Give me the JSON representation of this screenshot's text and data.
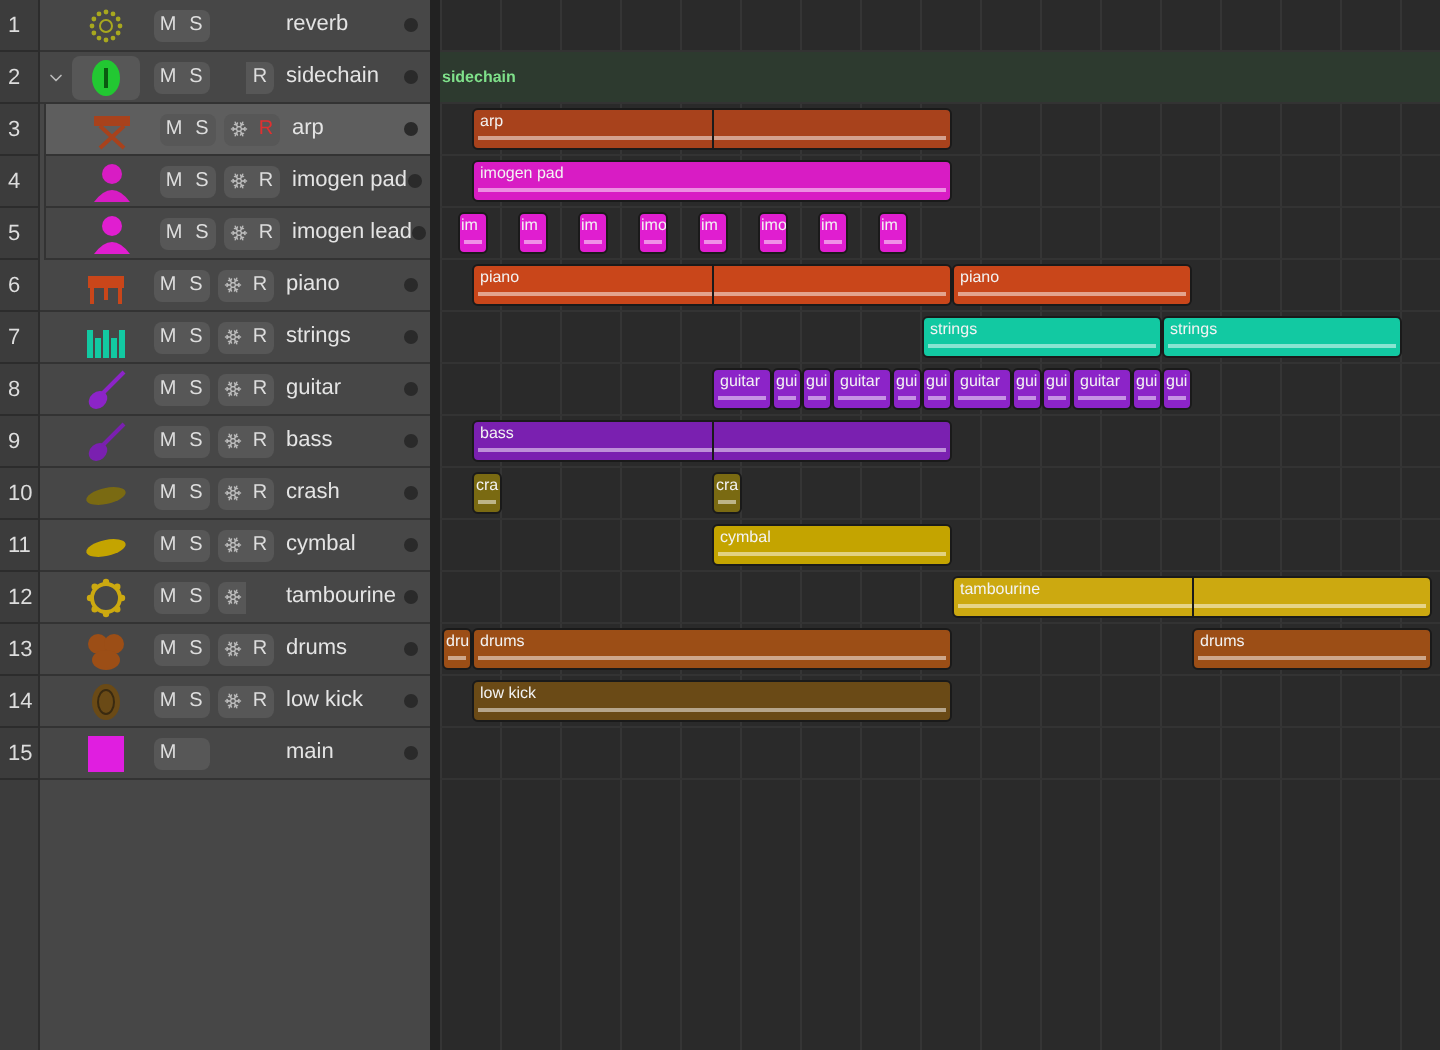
{
  "tracks": [
    {
      "number": "1",
      "name": "reverb",
      "color": "#a8a81e",
      "selected": false,
      "mute": "M",
      "solo": "S",
      "freeze": false
    },
    {
      "number": "2",
      "name": "sidechain",
      "color": "#22c832",
      "selected": false,
      "mute": "M",
      "solo": "S",
      "freeze": false,
      "record": {
        "label": "R",
        "armed": false
      },
      "expanded": true,
      "lane_label": "sidechain",
      "children": [
        {
          "number": "3",
          "name": "arp",
          "color": "#a8421c",
          "selected": true,
          "mute": "M",
          "solo": "S",
          "freeze": true,
          "record": {
            "label": "R",
            "armed": true
          },
          "regions": [
            {
              "label": "arp",
              "split": true
            }
          ]
        },
        {
          "number": "4",
          "name": "imogen pad",
          "color": "#d81cc4",
          "selected": false,
          "mute": "M",
          "solo": "S",
          "freeze": true,
          "record": {
            "label": "R",
            "armed": false
          },
          "regions": [
            {
              "label": "imogen pad"
            }
          ]
        },
        {
          "number": "5",
          "name": "imogen lead",
          "color": "#e01ed0",
          "selected": false,
          "mute": "M",
          "solo": "S",
          "freeze": true,
          "record": {
            "label": "R",
            "armed": false
          },
          "regions": [
            {
              "label": "im"
            },
            {
              "label": "im"
            },
            {
              "label": "im"
            },
            {
              "label": "imo"
            },
            {
              "label": "im"
            },
            {
              "label": "imo"
            },
            {
              "label": "im"
            },
            {
              "label": "im"
            }
          ]
        }
      ]
    },
    {
      "number": "6",
      "name": "piano",
      "color": "#c9461a",
      "selected": false,
      "mute": "M",
      "solo": "S",
      "freeze": true,
      "record": {
        "label": "R",
        "armed": false
      },
      "regions": [
        {
          "label": "piano",
          "split": true
        },
        {
          "label": "piano",
          "split": false
        }
      ]
    },
    {
      "number": "7",
      "name": "strings",
      "color": "#12c9a2",
      "selected": false,
      "mute": "M",
      "solo": "S",
      "freeze": true,
      "record": {
        "label": "R",
        "armed": false
      },
      "regions": [
        {
          "label": "strings"
        },
        {
          "label": "strings"
        }
      ]
    },
    {
      "number": "8",
      "name": "guitar",
      "color": "#8c24c8",
      "selected": false,
      "mute": "M",
      "solo": "S",
      "freeze": true,
      "record": {
        "label": "R",
        "armed": false
      },
      "regions": [
        {
          "label": "guitar"
        },
        {
          "label": "gui"
        },
        {
          "label": "gui"
        },
        {
          "label": "guitar"
        },
        {
          "label": "gui"
        },
        {
          "label": "gui"
        },
        {
          "label": "guitar"
        },
        {
          "label": "gui"
        },
        {
          "label": "gui"
        },
        {
          "label": "guitar"
        },
        {
          "label": "gui"
        },
        {
          "label": "gui"
        }
      ]
    },
    {
      "number": "9",
      "name": "bass",
      "color": "#7a20b0",
      "selected": false,
      "mute": "M",
      "solo": "S",
      "freeze": true,
      "record": {
        "label": "R",
        "armed": false
      },
      "regions": [
        {
          "label": "bass",
          "split": true
        }
      ]
    },
    {
      "number": "10",
      "name": "crash",
      "color": "#7a6a12",
      "selected": false,
      "mute": "M",
      "solo": "S",
      "freeze": true,
      "record": {
        "label": "R",
        "armed": false
      },
      "regions": [
        {
          "label": "cra"
        },
        {
          "label": "cra"
        }
      ]
    },
    {
      "number": "11",
      "name": "cymbal",
      "color": "#c4a400",
      "selected": false,
      "mute": "M",
      "solo": "S",
      "freeze": true,
      "record": {
        "label": "R",
        "armed": false
      },
      "regions": [
        {
          "label": "cymbal"
        }
      ]
    },
    {
      "number": "12",
      "name": "tambourine",
      "color": "#cca910",
      "selected": false,
      "mute": "M",
      "solo": "S",
      "freeze": true,
      "regions": [
        {
          "label": "tambourine",
          "split": true
        }
      ]
    },
    {
      "number": "13",
      "name": "drums",
      "color": "#9c4e16",
      "selected": false,
      "mute": "M",
      "solo": "S",
      "freeze": true,
      "record": {
        "label": "R",
        "armed": false
      },
      "regions": [
        {
          "label": "dru"
        },
        {
          "label": "drums"
        },
        {
          "label": "drums"
        }
      ]
    },
    {
      "number": "14",
      "name": "low kick",
      "color": "#6a4a16",
      "selected": false,
      "mute": "M",
      "solo": "S",
      "freeze": true,
      "record": {
        "label": "R",
        "armed": false
      },
      "regions": [
        {
          "label": "low kick"
        }
      ]
    },
    {
      "number": "15",
      "name": "main",
      "color": "#e01ee0",
      "selected": false,
      "mute": "M",
      "freeze": false
    }
  ]
}
